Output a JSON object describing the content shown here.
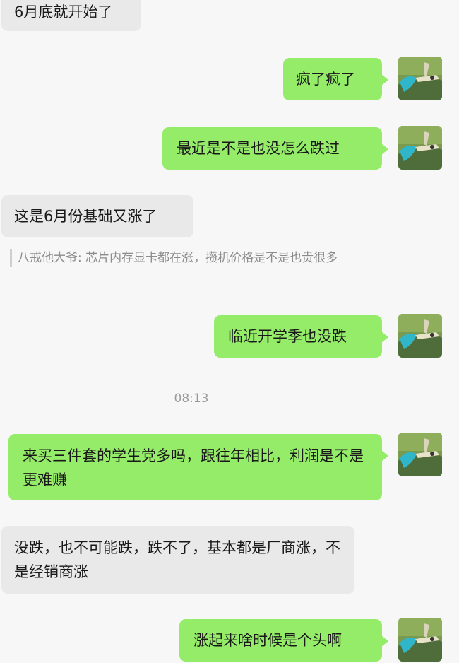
{
  "messages": [
    {
      "side": "in",
      "text": "6月底就开始了"
    },
    {
      "side": "out",
      "text": "疯了疯了"
    },
    {
      "side": "out",
      "text": "最近是不是也没怎么跌过"
    },
    {
      "side": "in",
      "text": "这是6月份基础又涨了"
    },
    {
      "side": "quote",
      "text": "八戒他大爷: 芯片内存显卡都在涨，攒机价格是不是也贵很多"
    },
    {
      "side": "out",
      "text": "临近开学季也没跌"
    },
    {
      "side": "time",
      "text": "08:13"
    },
    {
      "side": "out",
      "text": "来买三件套的学生党多吗，跟往年相比，利润是不是更难赚"
    },
    {
      "side": "in",
      "text": "没跌，也不可能跌，跌不了，基本都是厂商涨，不是经销商涨"
    },
    {
      "side": "out",
      "text": "涨起来啥时候是个头啊"
    }
  ],
  "colors": {
    "outgoing_bubble": "#95ec69",
    "incoming_bubble": "#e9e9e9",
    "background": "#f7f7f7"
  },
  "icons": {
    "avatar": "chameleon-avatar-icon"
  }
}
